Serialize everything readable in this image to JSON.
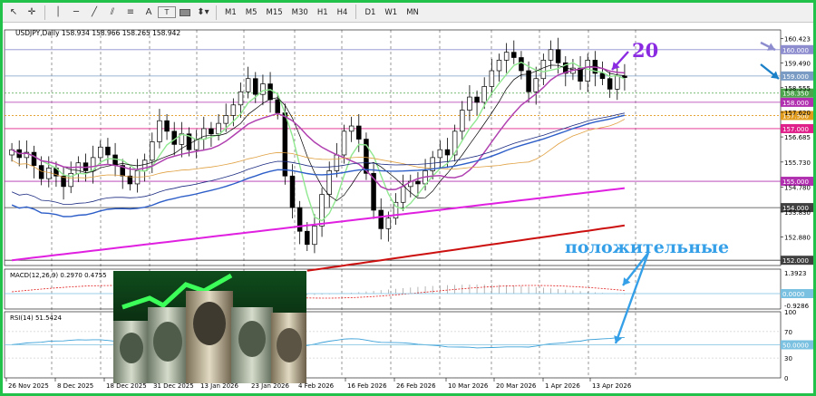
{
  "toolbar": {
    "timeframes": [
      "M1",
      "M5",
      "M15",
      "M30",
      "H1",
      "H4",
      "D1",
      "W1",
      "MN"
    ],
    "text_tool": "A",
    "text_tool2": "T"
  },
  "chart_data": {
    "type": "candlestick",
    "symbol_line": "USDJPY,Daily  158.934 158.966 158.265 158.942",
    "price_axis": {
      "min": 151.8,
      "max": 160.75,
      "ticks": [
        "160.423",
        "159.490",
        "158.555",
        "157.620",
        "156.685",
        "155.730",
        "154.780",
        "153.830",
        "152.880"
      ]
    },
    "price_labels": [
      {
        "value": "160.000",
        "price": 160.0,
        "color": "#8c8ccf"
      },
      {
        "value": "159.000",
        "price": 159.0,
        "color": "#7a9cc4"
      },
      {
        "value": "158.350",
        "price": 158.35,
        "color": "#4ba34b"
      },
      {
        "value": "158.000",
        "price": 158.0,
        "color": "#b030b0"
      },
      {
        "value": "157.500",
        "price": 157.5,
        "color": "#e09a1c"
      },
      {
        "value": "157.000",
        "price": 157.0,
        "color": "#e0208a"
      },
      {
        "value": "155.000",
        "price": 155.0,
        "color": "#b030b0"
      },
      {
        "value": "154.000",
        "price": 154.0,
        "color": "#404040"
      },
      {
        "value": "152.000",
        "price": 152.0,
        "color": "#404040"
      }
    ],
    "date_labels": [
      "26 Nov 2025",
      "8 Dec 2025",
      "18 Dec 2025",
      "31 Dec 2025",
      "13 Jan 2026",
      "23 Jan 2026",
      "4 Feb 2026",
      "16 Feb 2026",
      "26 Feb 2026",
      "10 Mar 2026",
      "20 Mar 2026",
      "1 Apr 2026",
      "13 Apr 2026"
    ],
    "macd": {
      "label": "MACD(12,26,9) 0.2970 0.4755",
      "ticks": [
        "1.3923",
        "0.0000",
        "-0.9286"
      ]
    },
    "rsi": {
      "label": "RSI(14) 51.5424",
      "ticks": [
        "100",
        "70",
        "50.0000",
        "30",
        "0"
      ]
    },
    "closes": [
      156.2,
      155.9,
      156.1,
      155.6,
      155.1,
      155.5,
      155.2,
      154.8,
      155.3,
      155.7,
      155.4,
      155.9,
      156.3,
      156.0,
      155.6,
      155.2,
      154.9,
      155.4,
      155.8,
      156.5,
      157.3,
      156.9,
      156.4,
      156.8,
      156.2,
      156.6,
      157.0,
      156.8,
      157.2,
      157.5,
      157.9,
      158.4,
      158.9,
      158.3,
      158.7,
      158.1,
      157.6,
      155.2,
      154.0,
      153.1,
      152.6,
      153.3,
      154.5,
      155.4,
      156.0,
      156.9,
      157.1,
      156.6,
      155.3,
      153.9,
      153.2,
      153.6,
      154.2,
      154.8,
      155.0,
      154.9,
      155.4,
      155.9,
      156.2,
      156.0,
      156.9,
      157.7,
      158.2,
      158.0,
      158.6,
      159.2,
      159.6,
      159.9,
      159.7,
      159.2,
      158.4,
      158.9,
      159.6,
      160.0,
      159.5,
      159.1,
      159.3,
      158.8,
      159.6,
      159.1,
      158.9,
      158.5,
      159.0,
      158.94
    ]
  },
  "annotations": {
    "number": "20",
    "word": "положительные"
  }
}
